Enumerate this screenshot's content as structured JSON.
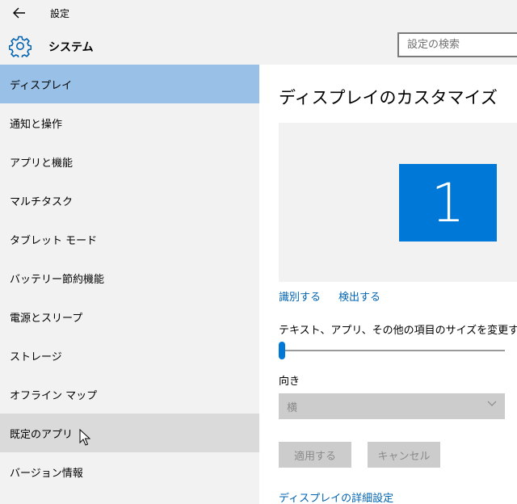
{
  "titlebar": {
    "title": "設定"
  },
  "header": {
    "title": "システム",
    "search_placeholder": "設定の検索"
  },
  "sidebar": {
    "items": [
      {
        "label": "ディスプレイ"
      },
      {
        "label": "通知と操作"
      },
      {
        "label": "アプリと機能"
      },
      {
        "label": "マルチタスク"
      },
      {
        "label": "タブレット モード"
      },
      {
        "label": "バッテリー節約機能"
      },
      {
        "label": "電源とスリープ"
      },
      {
        "label": "ストレージ"
      },
      {
        "label": "オフライン マップ"
      },
      {
        "label": "既定のアプリ"
      },
      {
        "label": "バージョン情報"
      }
    ]
  },
  "main": {
    "title": "ディスプレイのカスタマイズ",
    "monitor_number": "1",
    "identify_link": "識別する",
    "detect_link": "検出する",
    "size_label": "テキスト、アプリ、その他の項目のサイズを変更する:",
    "orientation_label": "向き",
    "orientation_value": "横",
    "apply_button": "適用する",
    "cancel_button": "キャンセル",
    "advanced_link": "ディスプレイの詳細設定"
  },
  "colors": {
    "accent": "#0078d7",
    "link": "#0063b1",
    "selected": "#99c1e7",
    "hover": "#dadada",
    "sidebar_bg": "#f2f2f2"
  },
  "icons": [
    "back-arrow-icon",
    "gear-icon",
    "chevron-down-icon",
    "mouse-cursor-icon"
  ]
}
